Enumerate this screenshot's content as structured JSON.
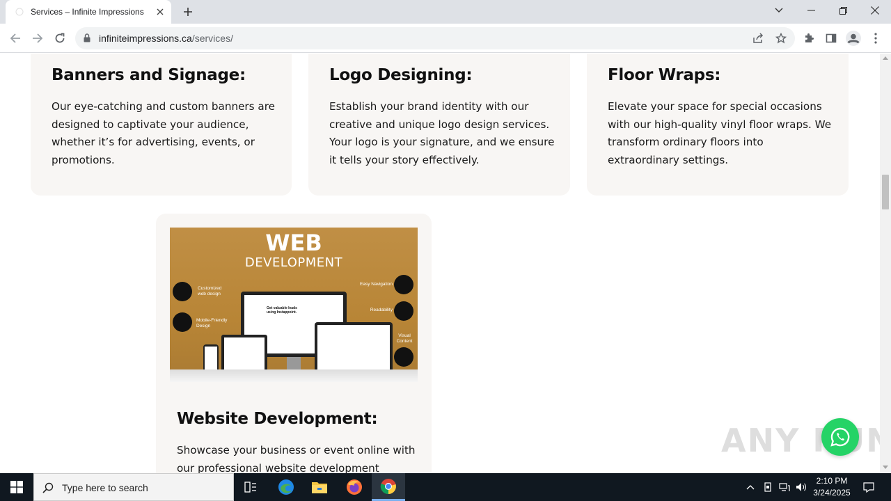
{
  "browser": {
    "tab_title": "Services – Infinite Impressions",
    "url_domain": "infiniteimpressions.ca",
    "url_path": "/services/"
  },
  "cards": {
    "banners": {
      "title": "Banners and Signage:",
      "text": "Our eye-catching and custom banners are designed to captivate your audience, whether it’s for advertising, events, or promotions."
    },
    "logo": {
      "title": "Logo Designing:",
      "text": "Establish your brand identity with our creative and unique logo design services. Your logo is your signature, and we ensure it tells your story effectively."
    },
    "floor": {
      "title": "Floor Wraps:",
      "text": "Elevate your space for special occasions with our high-quality vinyl floor wraps. We transform ordinary floors into extraordinary settings."
    },
    "web": {
      "title": "Website Development:",
      "text": "Showcase your business or event online with our professional website development",
      "image": {
        "heading": "WEB",
        "subheading": "DEVELOPMENT",
        "label_custom": "Customized web design",
        "label_mobile": "Mobile-Friendly Design",
        "label_nav": "Easy Navigation",
        "label_read": "Readability",
        "label_visual": "Visual Content",
        "screen_text": "Get valuable leads using Instappoint."
      }
    }
  },
  "watermark": "ANY RUN",
  "taskbar": {
    "search_placeholder": "Type here to search",
    "time": "2:10 PM",
    "date": "3/24/2025"
  },
  "colors": {
    "card_bg": "#f8f6f4",
    "image_gold": "#b88536",
    "whatsapp_green": "#25d366",
    "taskbar_bg": "#101820"
  }
}
